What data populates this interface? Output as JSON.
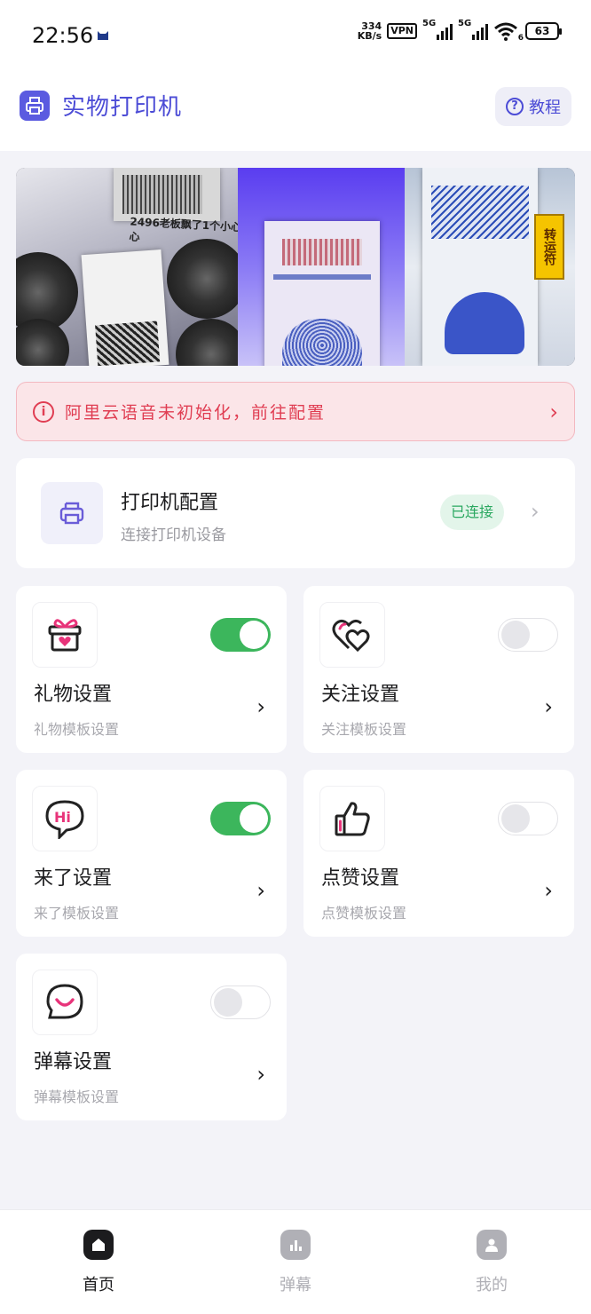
{
  "status_bar": {
    "time": "22:56",
    "net_speed_value": "334",
    "net_speed_unit": "KB/s",
    "vpn": "VPN",
    "sig1_label": "5G",
    "sig2_label": "5G",
    "wifi_label": "6",
    "battery": "63"
  },
  "header": {
    "title": "实物打印机",
    "tutorial_label": "教程"
  },
  "banner": {
    "caption": "2496老板飘了1个小心心",
    "fortune_text": "转运符"
  },
  "alert": {
    "text": "阿里云语音未初始化，前往配置"
  },
  "printer": {
    "title": "打印机配置",
    "subtitle": "连接打印机设备",
    "status": "已连接"
  },
  "tiles": [
    {
      "title": "礼物设置",
      "subtitle": "礼物模板设置",
      "icon": "gift-icon",
      "enabled": true
    },
    {
      "title": "关注设置",
      "subtitle": "关注模板设置",
      "icon": "hearts-icon",
      "enabled": false
    },
    {
      "title": "来了设置",
      "subtitle": "来了模板设置",
      "icon": "hi-bubble-icon",
      "enabled": true
    },
    {
      "title": "点赞设置",
      "subtitle": "点赞模板设置",
      "icon": "thumbs-up-icon",
      "enabled": false
    },
    {
      "title": "弹幕设置",
      "subtitle": "弹幕模板设置",
      "icon": "smile-bubble-icon",
      "enabled": false
    }
  ],
  "bottom_nav": [
    {
      "label": "首页",
      "icon": "home-icon",
      "active": true
    },
    {
      "label": "弹幕",
      "icon": "chart-icon",
      "active": false
    },
    {
      "label": "我的",
      "icon": "user-icon",
      "active": false
    }
  ],
  "colors": {
    "accent": "#4c4cd6",
    "toggle_on": "#3cb65c",
    "alert": "#e03d52",
    "connected": "#2aa860"
  }
}
